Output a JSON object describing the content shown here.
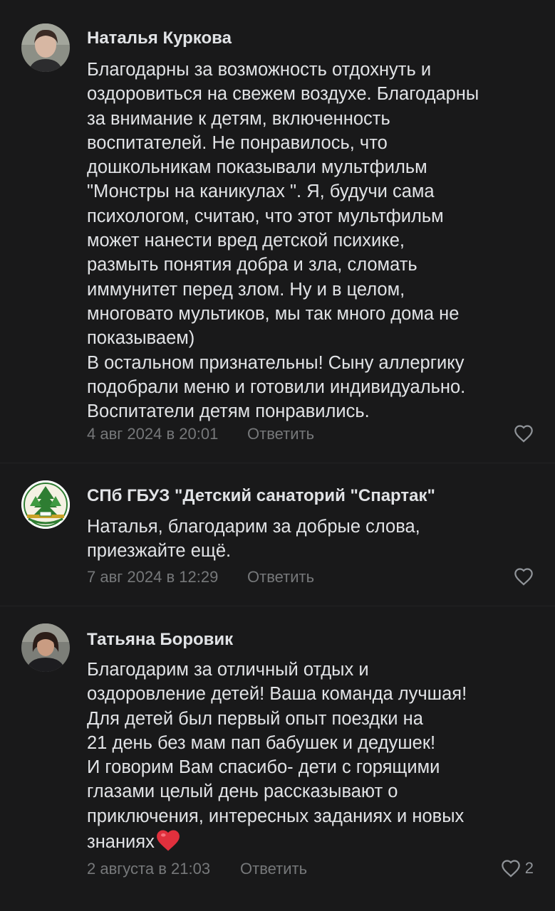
{
  "comments": [
    {
      "author": "Наталья Куркова",
      "avatar_icon": "user-photo",
      "text_lines": [
        "Благодарны за возможность отдохнуть и",
        "оздоровиться на свежем воздухе. Благодарны",
        "за внимание к детям, включенность",
        "воспитателей. Не понравилось, что",
        "дошкольникам показывали мультфильм",
        "\"Монстры на каникулах \". Я, будучи сама",
        "психологом, считаю, что этот мультфильм",
        "может нанести вред детской психике,",
        "размыть понятия добра и зла, сломать",
        "иммунитет перед злом. Ну и в целом,",
        "многовато мультиков, мы так много дома не",
        "показываем)",
        "В остальном признательны! Сыну аллергику",
        "подобрали меню и готовили индивидуально.",
        "Воспитатели детям понравились."
      ],
      "date": "4 авг 2024 в 20:01",
      "reply_label": "Ответить",
      "likes": ""
    },
    {
      "author": "СПб ГБУЗ \"Детский санаторий \"Спартак\"",
      "avatar_icon": "sanatorium-logo",
      "text_lines": [
        "Наталья, благодарим за добрые слова,",
        "приезжайте ещё."
      ],
      "date": "7 авг 2024 в 12:29",
      "reply_label": "Ответить",
      "likes": ""
    },
    {
      "author": "Татьяна Боровик",
      "avatar_icon": "user-photo",
      "text_lines": [
        "Благодарим за отличный отдых и",
        "оздоровление детей! Ваша команда лучшая!",
        "Для детей был первый опыт поездки на",
        "21 день без мам пап бабушек и дедушек!",
        "И говорим Вам спасибо- дети с горящими",
        "глазами целый день рассказывают о",
        "приключения, интересных заданиях и новых",
        "знаниях"
      ],
      "text_emoji": "❤️",
      "date": "2 августа в 21:03",
      "reply_label": "Ответить",
      "likes": "2"
    }
  ],
  "colors": {
    "background": "#19191a",
    "text": "#e1e3e6",
    "secondary": "#76787a",
    "heart_emoji": "#e0303d"
  }
}
